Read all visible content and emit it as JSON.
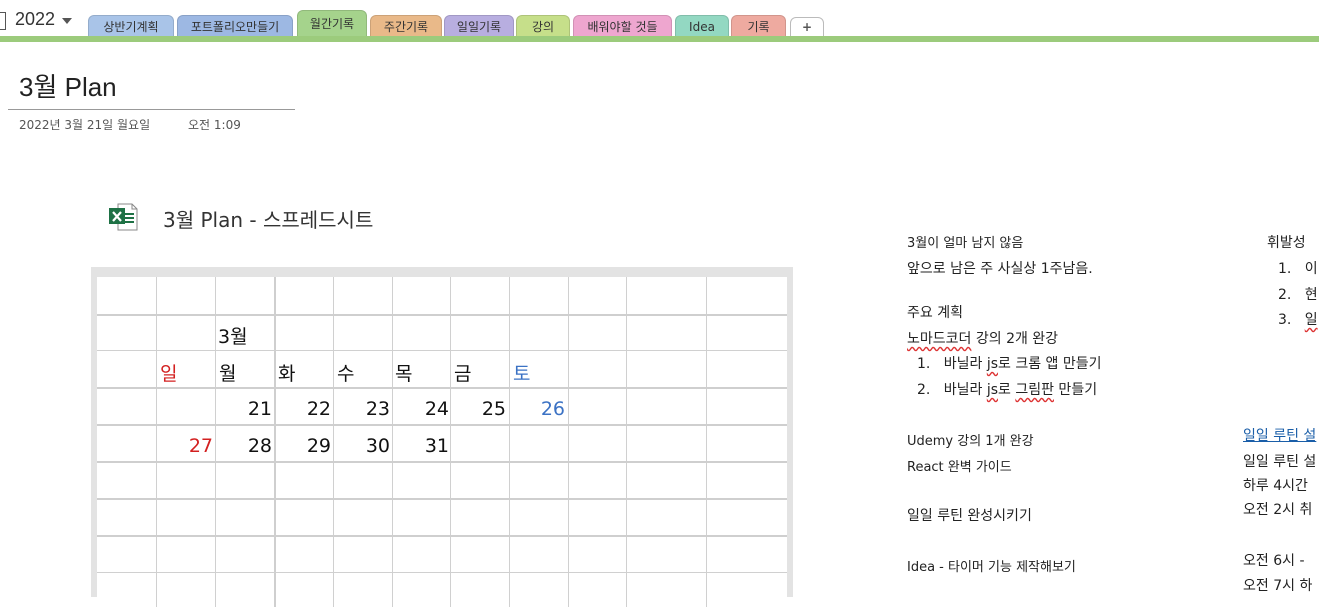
{
  "notebook": {
    "name": "2022"
  },
  "tabs": [
    {
      "label": "상반기계획",
      "color": "#a9c4e8"
    },
    {
      "label": "포트폴리오만들기",
      "color": "#9db8e3"
    },
    {
      "label": "월간기록",
      "color": "#a5d38c",
      "active": true
    },
    {
      "label": "주간기록",
      "color": "#e9b989"
    },
    {
      "label": "일일기록",
      "color": "#b8aee0"
    },
    {
      "label": "강의",
      "color": "#c6df8a"
    },
    {
      "label": "배워야할 것들",
      "color": "#eea6cf"
    },
    {
      "label": "Idea",
      "color": "#93d8c2"
    },
    {
      "label": "기록",
      "color": "#eeaaa0"
    },
    {
      "label": "+",
      "color": "#ffffff"
    }
  ],
  "page": {
    "title": "3월 Plan",
    "date": "2022년 3월 21일 월요일",
    "time": "오전 1:09"
  },
  "attachment": {
    "title": "3월 Plan - 스프레드시트",
    "icon": "excel-file-icon"
  },
  "calendar": {
    "month": "3월",
    "weekdays": [
      "일",
      "월",
      "화",
      "수",
      "목",
      "금",
      "토"
    ],
    "week1": [
      "",
      "21",
      "22",
      "23",
      "24",
      "25",
      "26"
    ],
    "week2": [
      "27",
      "28",
      "29",
      "30",
      "31",
      "",
      ""
    ],
    "colors": {
      "sunday": "#d32020",
      "saturday": "#3b72c4"
    }
  },
  "notes": {
    "line1": "3월이 얼마 남지 않음",
    "line2": "앞으로 남은 주 사실상 1주남음.",
    "main_plan": "주요 계획",
    "nomad_a": "노마드코더",
    "nomad_b": " 강의 2개 완강",
    "item1_num": "1.",
    "item1_a": "바닐라 ",
    "item1_b": "js",
    "item1_c": "로 크롬 앱 만들기",
    "item2_num": "2.",
    "item2_a": "바닐라 ",
    "item2_b": "js",
    "item2_c": "로 ",
    "item2_d": "그림판",
    "item2_e": " 만들기",
    "udemy": "Udemy 강의 1개 완강",
    "react": "React 완벽 가이드",
    "routine": "일일 루틴 완성시키기",
    "idea": "Idea - 타이머 기능 제작해보기"
  },
  "notes_right": {
    "volatile": "휘발성 ",
    "r1_num": "1.",
    "r1": "이",
    "r2_num": "2.",
    "r2": "현",
    "r3_num": "3.",
    "r3": "일",
    "link": "일일 루틴 설",
    "r4": "일일 루틴 설",
    "r5": "하루 4시간",
    "r6": "오전 2시 취",
    "r7": "오전 6시 - ",
    "r8": "오전 7시 하"
  }
}
